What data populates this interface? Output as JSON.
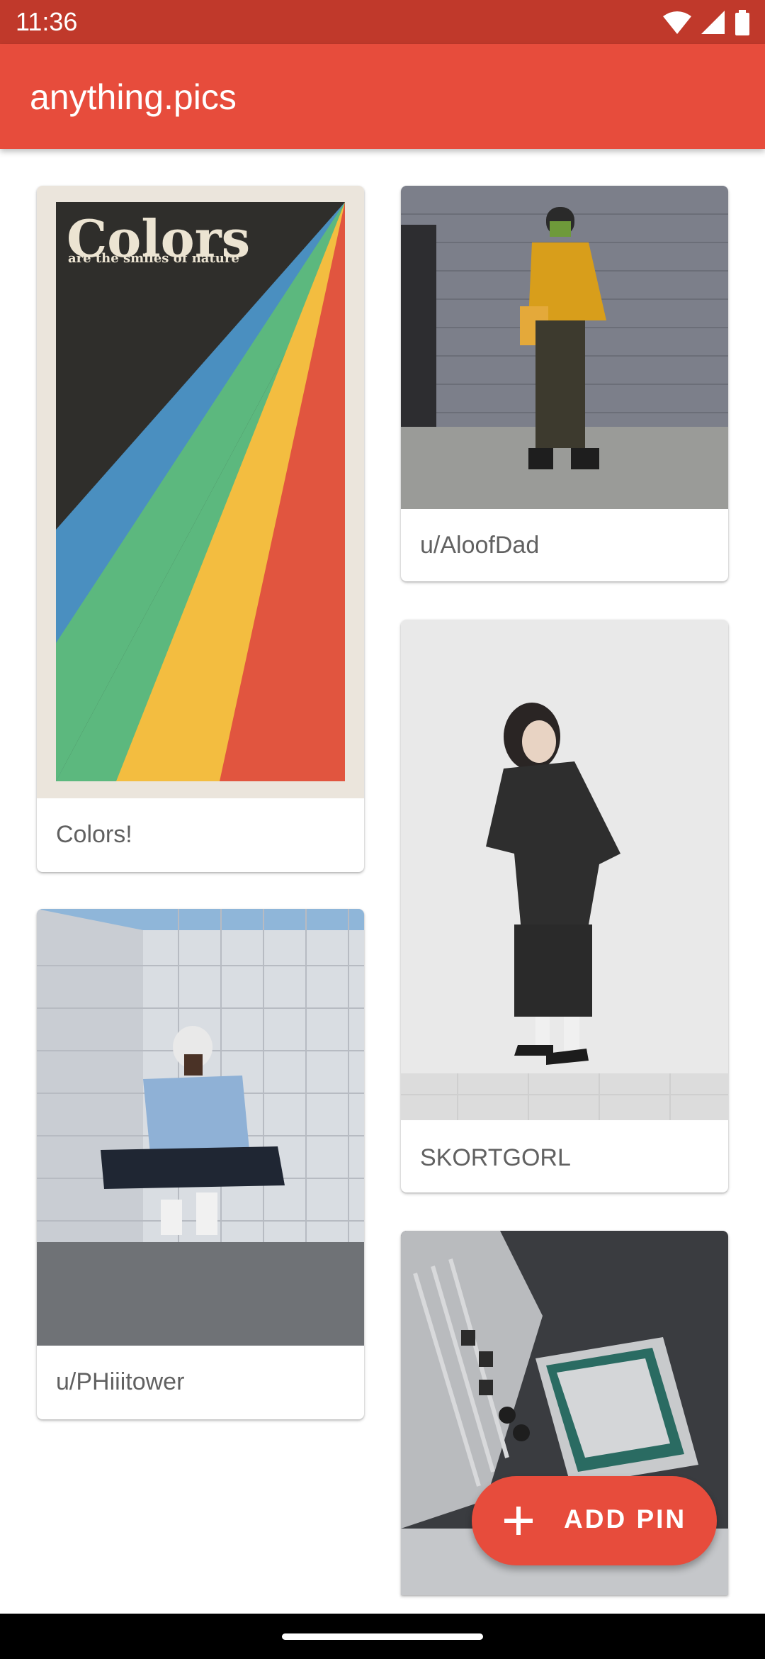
{
  "status_bar": {
    "time": "11:36",
    "icons": [
      "wifi-icon",
      "signal-icon",
      "battery-icon"
    ]
  },
  "app_bar": {
    "title": "anything.pics",
    "color": "#e74c3c"
  },
  "pins": [
    {
      "label": "Colors!",
      "image": "rainbow colors poster"
    },
    {
      "label": "u/AloofDad",
      "image": "person in yellow jacket by brick wall"
    },
    {
      "label": "SKORTGORL",
      "image": "person in black outfit against white wall"
    },
    {
      "label": "u/PHiiitower",
      "image": "person jumping in front of tiled wall"
    },
    {
      "label": "",
      "image": "motherboard with CPU"
    }
  ],
  "poster": {
    "title": "Colors",
    "subtitle": "are the smiles of nature"
  },
  "fab": {
    "label": "ADD PIN",
    "icon": "plus-icon",
    "color": "#e74c3c"
  }
}
